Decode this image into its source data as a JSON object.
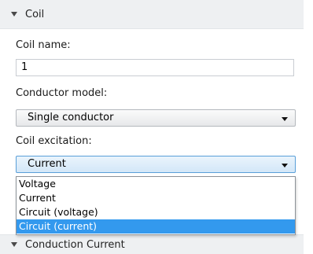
{
  "section": {
    "title": "Coil"
  },
  "coil_name": {
    "label": "Coil name:",
    "value": "1"
  },
  "conductor_model": {
    "label": "Conductor model:",
    "selected": "Single conductor"
  },
  "coil_excitation": {
    "label": "Coil excitation:",
    "selected": "Current",
    "options": [
      "Voltage",
      "Current",
      "Circuit (voltage)",
      "Circuit (current)"
    ],
    "highlighted_option": "Circuit (current)"
  },
  "next_section": {
    "title": "Conduction Current"
  },
  "colors": {
    "highlight": "#3399ee",
    "header_bg": "#eef0f2",
    "active_border": "#5a9fd8"
  }
}
